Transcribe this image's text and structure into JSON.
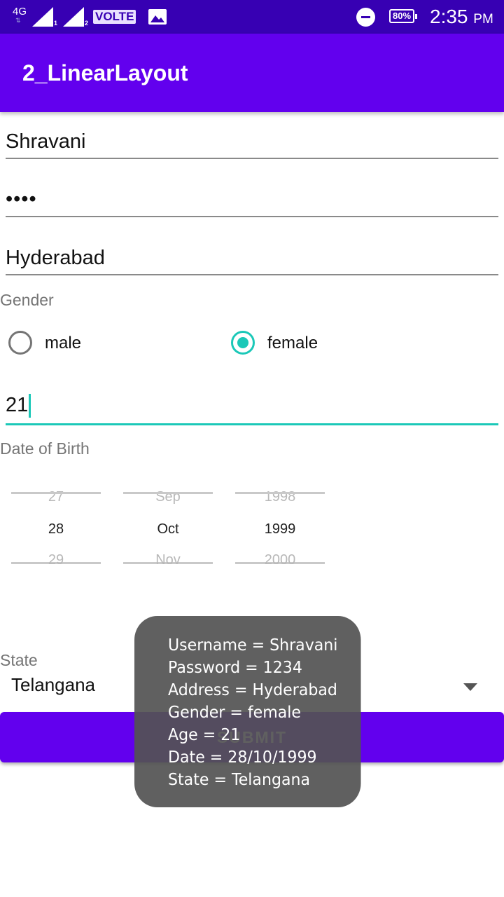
{
  "status_bar": {
    "network": "4G",
    "sim1": "1",
    "sim2": "2",
    "volte": "VOLTE",
    "battery": "80%",
    "time": "2:35",
    "ampm": "PM"
  },
  "app_bar": {
    "title": "2_LinearLayout"
  },
  "form": {
    "username_value": "Shravani",
    "password_value": "••••",
    "address_value": "Hyderabad",
    "gender_label": "Gender",
    "gender_options": [
      {
        "label": "male",
        "checked": false
      },
      {
        "label": "female",
        "checked": true
      }
    ],
    "age_value": "21",
    "dob_label": "Date of Birth",
    "date_picker": {
      "day": {
        "prev": "27",
        "current": "28",
        "next": "29"
      },
      "month": {
        "prev": "Sep",
        "current": "Oct",
        "next": "Nov"
      },
      "year": {
        "prev": "1998",
        "current": "1999",
        "next": "2000"
      }
    },
    "state_label": "State",
    "state_value": "Telangana",
    "submit_label": "SUBMIT"
  },
  "toast": {
    "lines": [
      "Username = Shravani",
      "Password = 1234",
      "Address = Hyderabad",
      "Gender = female",
      "Age = 21",
      "Date = 28/10/1999",
      "State = Telangana"
    ]
  },
  "colors": {
    "status_bar": "#3700b3",
    "primary": "#6200ee",
    "accent": "#1bc8b8"
  }
}
